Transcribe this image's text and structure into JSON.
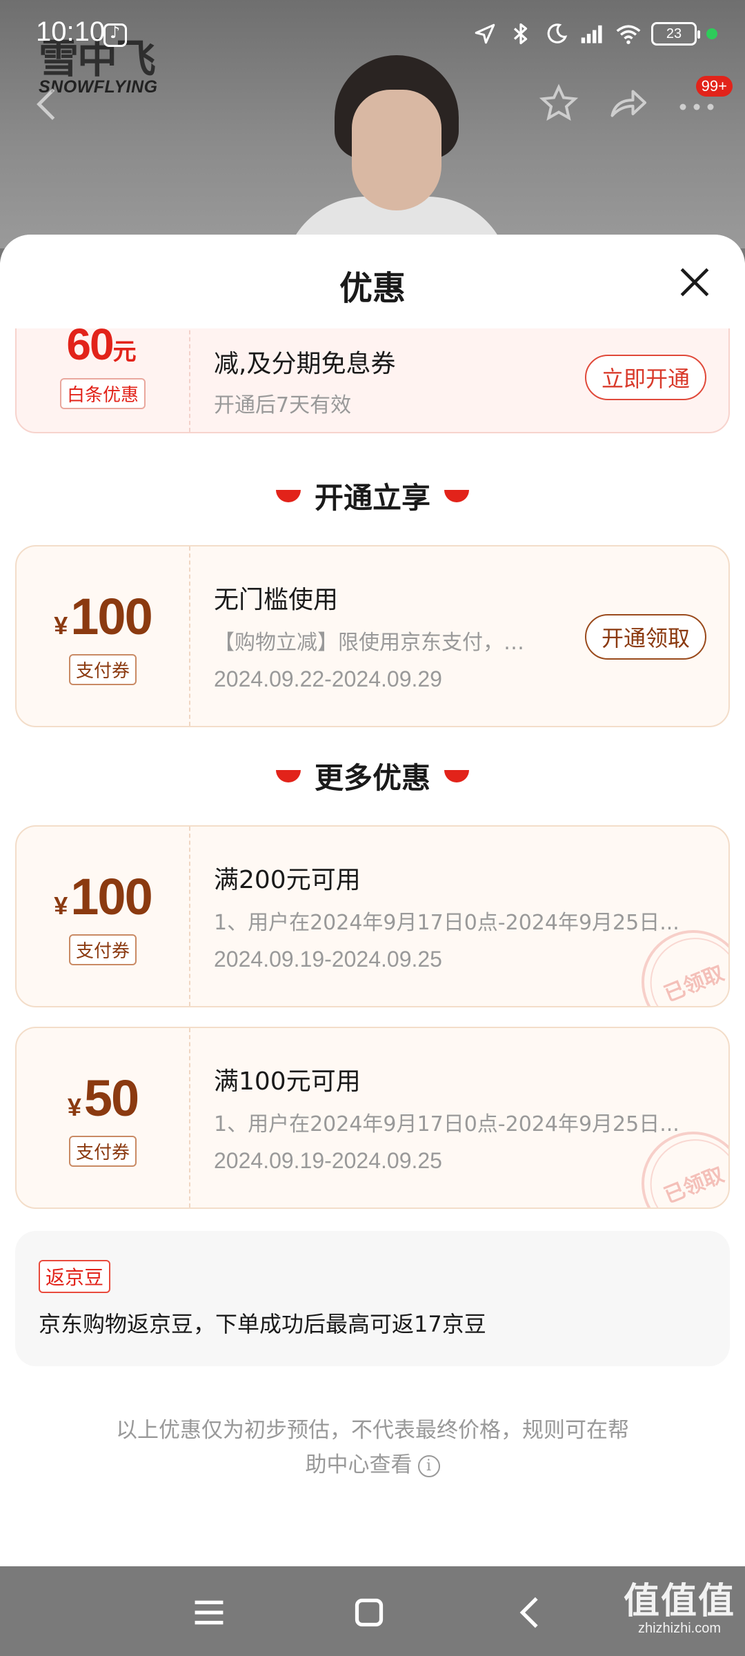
{
  "status_bar": {
    "time": "10:10",
    "battery": "23"
  },
  "brand": {
    "logo_cn": "雪中飞",
    "logo_en": "SNOWFLYING"
  },
  "nav": {
    "cart_badge": "99+"
  },
  "sheet": {
    "title": "优惠"
  },
  "baitiao": {
    "amount": "60",
    "unit": "元",
    "tag": "白条优惠",
    "title": "减,及分期免息券",
    "validity": "开通后7天有效",
    "button": "立即开通"
  },
  "section_open": {
    "title": "开通立享"
  },
  "open_coupon": {
    "symbol": "¥",
    "amount": "100",
    "tag": "支付券",
    "title": "无门槛使用",
    "desc": "【购物立减】限使用京东支付，…",
    "dates": "2024.09.22-2024.09.29",
    "button": "开通领取"
  },
  "section_more": {
    "title": "更多优惠"
  },
  "more_coupons": [
    {
      "symbol": "¥",
      "amount": "100",
      "tag": "支付券",
      "title": "满200元可用",
      "desc": "1、用户在2024年9月17日0点-2024年9月25日...",
      "dates": "2024.09.19-2024.09.25",
      "stamp": "已领取"
    },
    {
      "symbol": "¥",
      "amount": "50",
      "tag": "支付券",
      "title": "满100元可用",
      "desc": "1、用户在2024年9月17日0点-2024年9月25日...",
      "dates": "2024.09.19-2024.09.25",
      "stamp": "已领取"
    }
  ],
  "jingdou": {
    "tag": "返京豆",
    "text": "京东购物返京豆，下单成功后最高可返17京豆"
  },
  "disclaimer": {
    "line1": "以上优惠仅为初步预估，不代表最终价格，规则可在帮",
    "line2": "助中心查看"
  },
  "watermark": {
    "cn": "值值值",
    "en": "zhizhizhi.com"
  },
  "colors": {
    "accent_red": "#e2231a",
    "coupon_brown": "#8b3a10"
  }
}
